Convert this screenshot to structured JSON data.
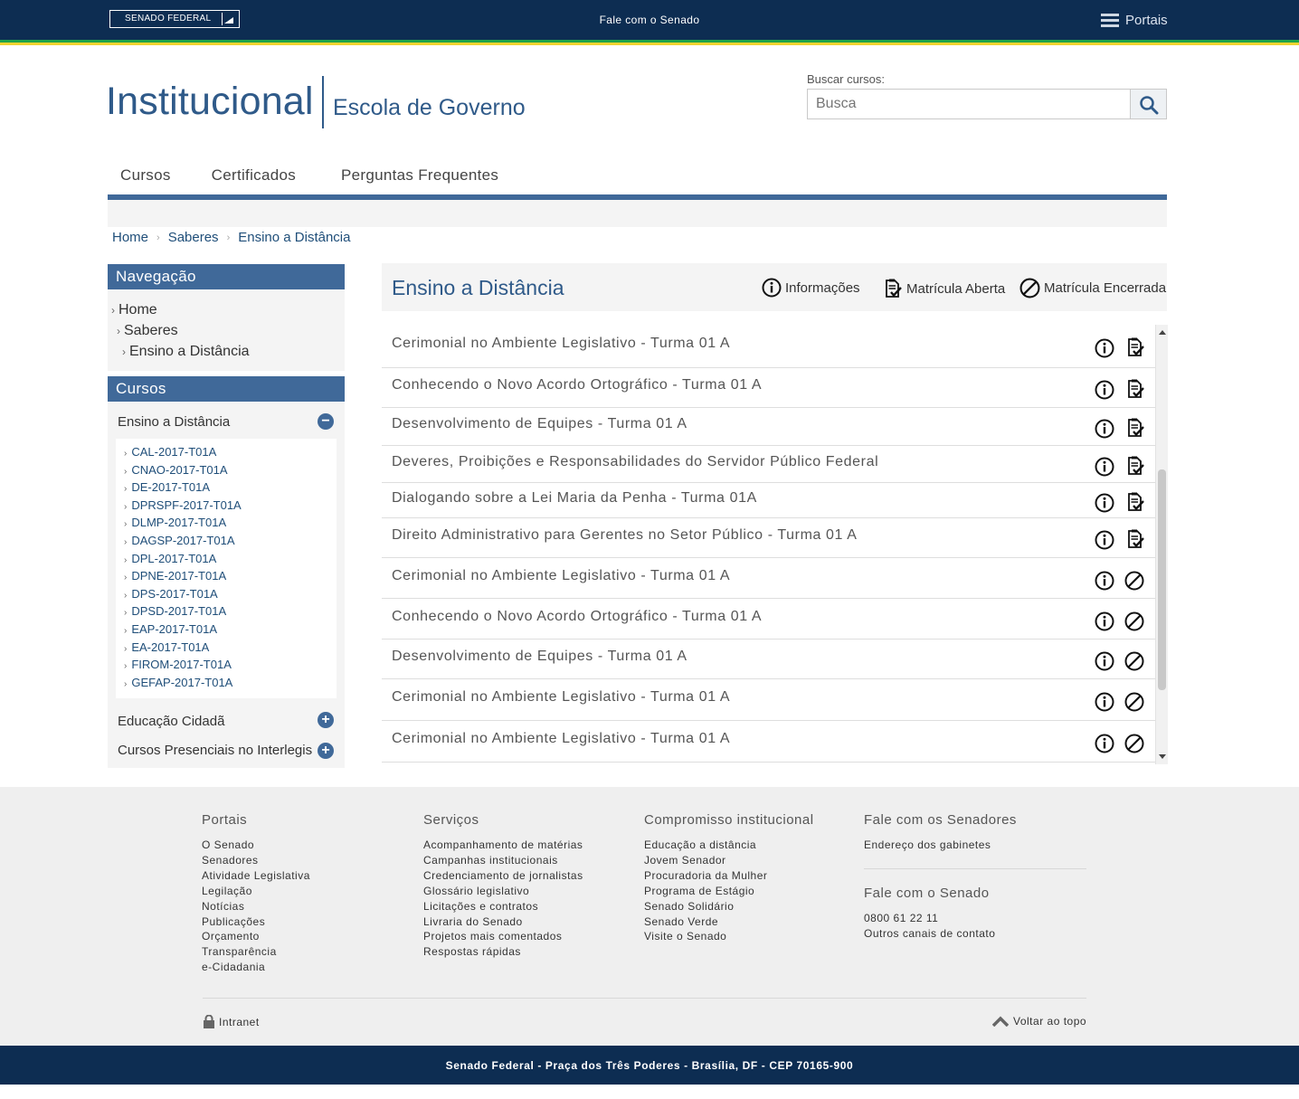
{
  "topbar": {
    "logo": "SENADO FEDERAL",
    "fale": "Fale com o Senado",
    "portais": "Portais"
  },
  "header": {
    "title": "Institucional",
    "subtitle": "Escola de Governo",
    "search_label": "Buscar cursos:",
    "search_placeholder": "Busca"
  },
  "nav": {
    "items": [
      "Cursos",
      "Certificados",
      "Perguntas Frequentes"
    ]
  },
  "breadcrumb": [
    "Home",
    "Saberes",
    "Ensino a Distância"
  ],
  "sidebar": {
    "nav_title": "Navegação",
    "nav_items": [
      "Home",
      "Saberes",
      "Ensino a Distância"
    ],
    "cursos_title": "Cursos",
    "categories": [
      "Ensino a Distância",
      "Educação Cidadã",
      "Cursos Presenciais no Interlegis"
    ],
    "codes": [
      "CAL-2017-T01A",
      "CNAO-2017-T01A",
      "DE-2017-T01A",
      "DPRSPF-2017-T01A",
      "DLMP-2017-T01A",
      "DAGSP-2017-T01A",
      "DPL-2017-T01A",
      "DPNE-2017-T01A",
      "DPS-2017-T01A",
      "DPSD-2017-T01A",
      "EAP-2017-T01A",
      "EA-2017-T01A",
      "FIROM-2017-T01A",
      "GEFAP-2017-T01A"
    ]
  },
  "main": {
    "title": "Ensino a Distância",
    "legend": {
      "info": "Informações",
      "open": "Matrícula Aberta",
      "closed": "Matrícula Encerrada"
    },
    "courses": [
      {
        "title": "Cerimonial no Ambiente Legislativo - Turma 01 A",
        "status": "open"
      },
      {
        "title": "Conhecendo o Novo Acordo Ortográfico - Turma 01 A",
        "status": "open"
      },
      {
        "title": "Desenvolvimento de Equipes - Turma 01 A",
        "status": "open"
      },
      {
        "title": "Deveres, Proibições e Responsabilidades do Servidor Público Federal",
        "status": "open"
      },
      {
        "title": "Dialogando sobre a Lei Maria da Penha - Turma 01A",
        "status": "open"
      },
      {
        "title": "Direito Administrativo para Gerentes no Setor Público - Turma 01 A",
        "status": "open"
      },
      {
        "title": "Cerimonial no Ambiente Legislativo - Turma 01 A",
        "status": "closed"
      },
      {
        "title": "Conhecendo o Novo Acordo Ortográfico - Turma 01 A",
        "status": "closed"
      },
      {
        "title": "Desenvolvimento de Equipes - Turma 01 A",
        "status": "closed"
      },
      {
        "title": "Cerimonial no Ambiente Legislativo - Turma 01 A",
        "status": "closed"
      },
      {
        "title": "Cerimonial no Ambiente Legislativo - Turma 01 A",
        "status": "closed"
      }
    ]
  },
  "footer": {
    "portais": {
      "title": "Portais",
      "links": [
        "O Senado",
        "Senadores",
        "Atividade Legislativa",
        "Legilação",
        "Notícias",
        "Publicações",
        "Orçamento",
        "Transparência",
        "e-Cidadania"
      ]
    },
    "servicos": {
      "title": "Serviços",
      "links": [
        "Acompanhamento de matérias",
        "Campanhas institucionais",
        "Credenciamento de jornalistas",
        "Glossário legislativo",
        "Licitações e contratos",
        "Livraria do Senado",
        "Projetos mais comentados",
        "Respostas rápidas"
      ]
    },
    "compromisso": {
      "title": "Compromisso institucional",
      "links": [
        "Educação a distância",
        "Jovem Senador",
        "Procuradoria da Mulher",
        "Programa de Estágio",
        "Senado Solidário",
        "Senado Verde",
        "Visite o Senado"
      ]
    },
    "senadores": {
      "title": "Fale com os Senadores",
      "links": [
        "Endereço dos gabinetes"
      ]
    },
    "fale": {
      "title": "Fale com o Senado",
      "links": [
        "0800 61 22 11",
        "Outros canais de contato"
      ]
    },
    "intranet": "Intranet",
    "topo": "Voltar ao topo",
    "address": "Senado Federal - Praça dos Três Poderes - Brasília, DF - CEP 70165-900"
  }
}
